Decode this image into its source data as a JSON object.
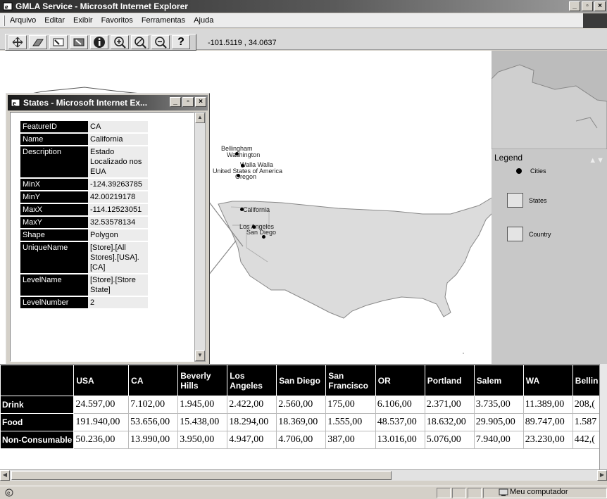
{
  "window": {
    "title": "GMLA Service - Microsoft Internet Explorer",
    "min": "_",
    "max": "▫",
    "close": "×"
  },
  "menu": [
    "Arquivo",
    "Editar",
    "Exibir",
    "Favoritos",
    "Ferramentas",
    "Ajuda"
  ],
  "toolbar": {
    "tools": [
      "pan-icon",
      "eraser-icon",
      "select-icon",
      "select-rect-icon",
      "info-icon",
      "zoom-in-icon",
      "zoom-extent-icon",
      "zoom-out-icon",
      "help-icon"
    ],
    "help_label": "?",
    "coordinates": "-101.5119 , 34.0637"
  },
  "popup": {
    "title": "States - Microsoft Internet Ex...",
    "properties": [
      {
        "key": "FeatureID",
        "value": "CA"
      },
      {
        "key": "Name",
        "value": "California"
      },
      {
        "key": "Description",
        "value": "Estado Localizado nos EUA"
      },
      {
        "key": "MinX",
        "value": "-124.39263785"
      },
      {
        "key": "MinY",
        "value": "42.00219178"
      },
      {
        "key": "MaxX",
        "value": "-114.12523051"
      },
      {
        "key": "MaxY",
        "value": "32.53578134"
      },
      {
        "key": "Shape",
        "value": "Polygon"
      },
      {
        "key": "UniqueName",
        "value": "[Store].[All Stores].[USA].[CA]"
      },
      {
        "key": "LevelName",
        "value": "[Store].[Store State]"
      },
      {
        "key": "LevelNumber",
        "value": "2"
      }
    ]
  },
  "map": {
    "labels": [
      "Bellingham",
      "Washington",
      "Walla Walla",
      "United States of America",
      "Oregon",
      "California",
      "Los Angeles",
      "San Diego"
    ]
  },
  "legend": {
    "title": "Legend",
    "arrows": "▲▼",
    "items": [
      "Cities",
      "States",
      "Country"
    ]
  },
  "grid": {
    "columns": [
      "USA",
      "CA",
      "Beverly Hills",
      "Los Angeles",
      "San Diego",
      "San Francisco",
      "OR",
      "Portland",
      "Salem",
      "WA",
      "Bellin"
    ],
    "rows": [
      {
        "label": "Drink",
        "values": [
          "24.597,00",
          "7.102,00",
          "1.945,00",
          "2.422,00",
          "2.560,00",
          "175,00",
          "6.106,00",
          "2.371,00",
          "3.735,00",
          "11.389,00",
          "208,("
        ]
      },
      {
        "label": "Food",
        "values": [
          "191.940,00",
          "53.656,00",
          "15.438,00",
          "18.294,00",
          "18.369,00",
          "1.555,00",
          "48.537,00",
          "18.632,00",
          "29.905,00",
          "89.747,00",
          "1.587"
        ]
      },
      {
        "label": "Non-Consumable",
        "values": [
          "50.236,00",
          "13.990,00",
          "3.950,00",
          "4.947,00",
          "4.706,00",
          "387,00",
          "13.016,00",
          "5.076,00",
          "7.940,00",
          "23.230,00",
          "442,("
        ]
      }
    ]
  },
  "status": {
    "zone": "Meu computador"
  }
}
